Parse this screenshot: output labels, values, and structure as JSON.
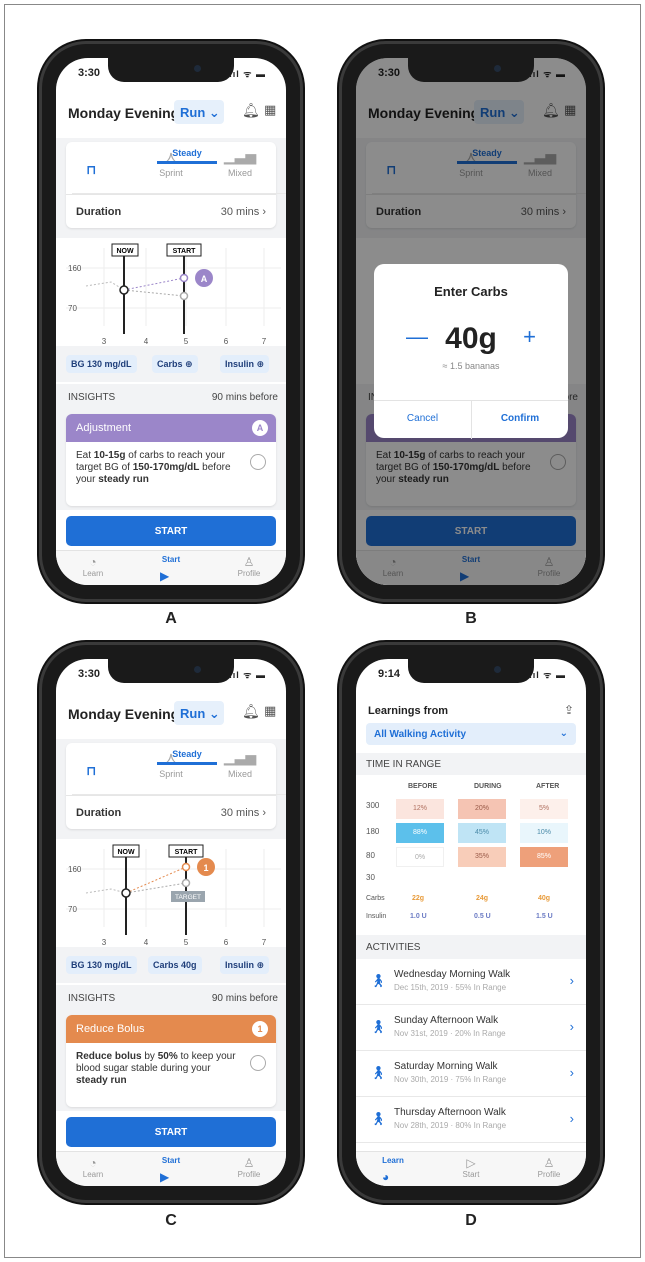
{
  "captions": [
    "A",
    "B",
    "C",
    "D"
  ],
  "status": {
    "time_abc": "3:30",
    "time_d": "9:14",
    "signal": "..ıl ᯤ ▬"
  },
  "header": {
    "title": "Monday Evening",
    "run_label": "Run"
  },
  "tabs": [
    "Steady",
    "Sprint",
    "Mixed"
  ],
  "duration": {
    "label": "Duration",
    "value": "30 mins"
  },
  "chart": {
    "now": "NOW",
    "start": "START",
    "target": "TARGET",
    "y_ticks": [
      "160",
      "70"
    ],
    "x_ticks": [
      "3",
      "4",
      "5",
      "6",
      "7"
    ],
    "badge_a": "A",
    "badge_c": "1"
  },
  "pills_a": {
    "bg": "BG 130 mg/dL",
    "carbs": "Carbs",
    "insulin": "Insulin"
  },
  "pills_c": {
    "bg": "BG 130 mg/dL",
    "carbs": "Carbs 40g",
    "insulin": "Insulin"
  },
  "insights": {
    "label": "INSIGHTS",
    "timing": "90 mins before"
  },
  "insight_a": {
    "title": "Adjustment",
    "badge": "A",
    "pre": "Eat ",
    "b1": "10-15g",
    "mid1": " of carbs to reach your target BG of ",
    "b2": "150-170mg/dL",
    "mid2": " before your ",
    "b3": "steady run"
  },
  "insight_c": {
    "title": "Reduce Bolus",
    "badge": "1",
    "b1": "Reduce bolus",
    "mid1": " by ",
    "b2": "50%",
    "mid2": " to keep your blood sugar stable during your ",
    "b3": "steady run"
  },
  "start_button": "START",
  "nav": [
    "Learn",
    "Start",
    "Profile"
  ],
  "modal": {
    "title": "Enter Carbs",
    "minus": "—",
    "plus": "+",
    "value": "40g",
    "sub": "≈ 1.5 bananas",
    "cancel": "Cancel",
    "confirm": "Confirm"
  },
  "learn": {
    "title": "Learnings from",
    "filter": "All Walking Activity",
    "tir_label": "TIME IN RANGE",
    "columns": [
      "BEFORE",
      "DURING",
      "AFTER"
    ],
    "y_axis": [
      "300",
      "180",
      "80",
      "30"
    ],
    "rows": [
      [
        "12%",
        "20%",
        "5%"
      ],
      [
        "88%",
        "45%",
        "10%"
      ],
      [
        "0%",
        "35%",
        "85%"
      ]
    ],
    "carbs_label": "Carbs",
    "carbs": [
      "22g",
      "24g",
      "40g"
    ],
    "insulin_label": "Insulin",
    "insulin": [
      "1.0 U",
      "0.5 U",
      "1.5 U"
    ],
    "activities_label": "ACTIVITIES",
    "activities": [
      {
        "name": "Wednesday Morning Walk",
        "sub": "Dec 15th, 2019 · 55% In Range"
      },
      {
        "name": "Sunday Afternoon Walk",
        "sub": "Nov 31st, 2019 · 20% In Range"
      },
      {
        "name": "Saturday Morning Walk",
        "sub": "Nov 30th, 2019 · 75% In Range"
      },
      {
        "name": "Thursday Afternoon Walk",
        "sub": "Nov 28th, 2019 · 80% In Range"
      }
    ]
  },
  "colors": {
    "accent": "#1f6fd6",
    "purple": "#9b86c9",
    "orange": "#e48a4e"
  }
}
